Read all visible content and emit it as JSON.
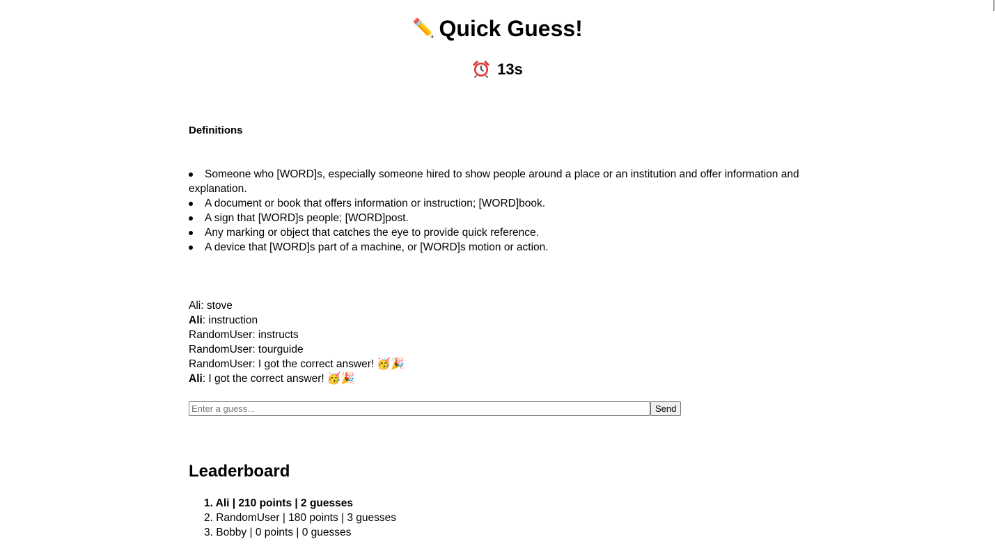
{
  "header": {
    "title_icon": "✏️",
    "title": "Quick Guess!",
    "timer_icon": "alarm-clock-icon",
    "timer": "13s"
  },
  "definitions": {
    "heading": "Definitions",
    "items": [
      "Someone who [WORD]s, especially someone hired to show people around a place or an institution and offer information and explanation.",
      "A document or book that offers information or instruction; [WORD]book.",
      "A sign that [WORD]s people; [WORD]post.",
      "Any marking or object that catches the eye to provide quick reference.",
      "A device that [WORD]s part of a machine, or [WORD]s motion or action."
    ]
  },
  "chat": {
    "messages": [
      {
        "user": "Ali",
        "text": ": stove"
      },
      {
        "user": "Ali",
        "text": ": instruction"
      },
      {
        "user": "RandomUser",
        "text": ": instructs"
      },
      {
        "user": "RandomUser",
        "text": ": tourguide"
      },
      {
        "user": "RandomUser",
        "text": ": I got the correct answer!",
        "emojis": "🥳🎉"
      },
      {
        "user": "Ali",
        "text": ": I got the correct answer!",
        "emojis": "🥳🎉"
      }
    ]
  },
  "guess": {
    "placeholder": "Enter a guess...",
    "value": "",
    "send_label": "Send"
  },
  "leaderboard": {
    "heading": "Leaderboard",
    "entries": [
      "1. Ali | 210 points | 2 guesses",
      "2. RandomUser | 180 points | 3 guesses",
      "3. Bobby | 0 points | 0 guesses"
    ]
  }
}
